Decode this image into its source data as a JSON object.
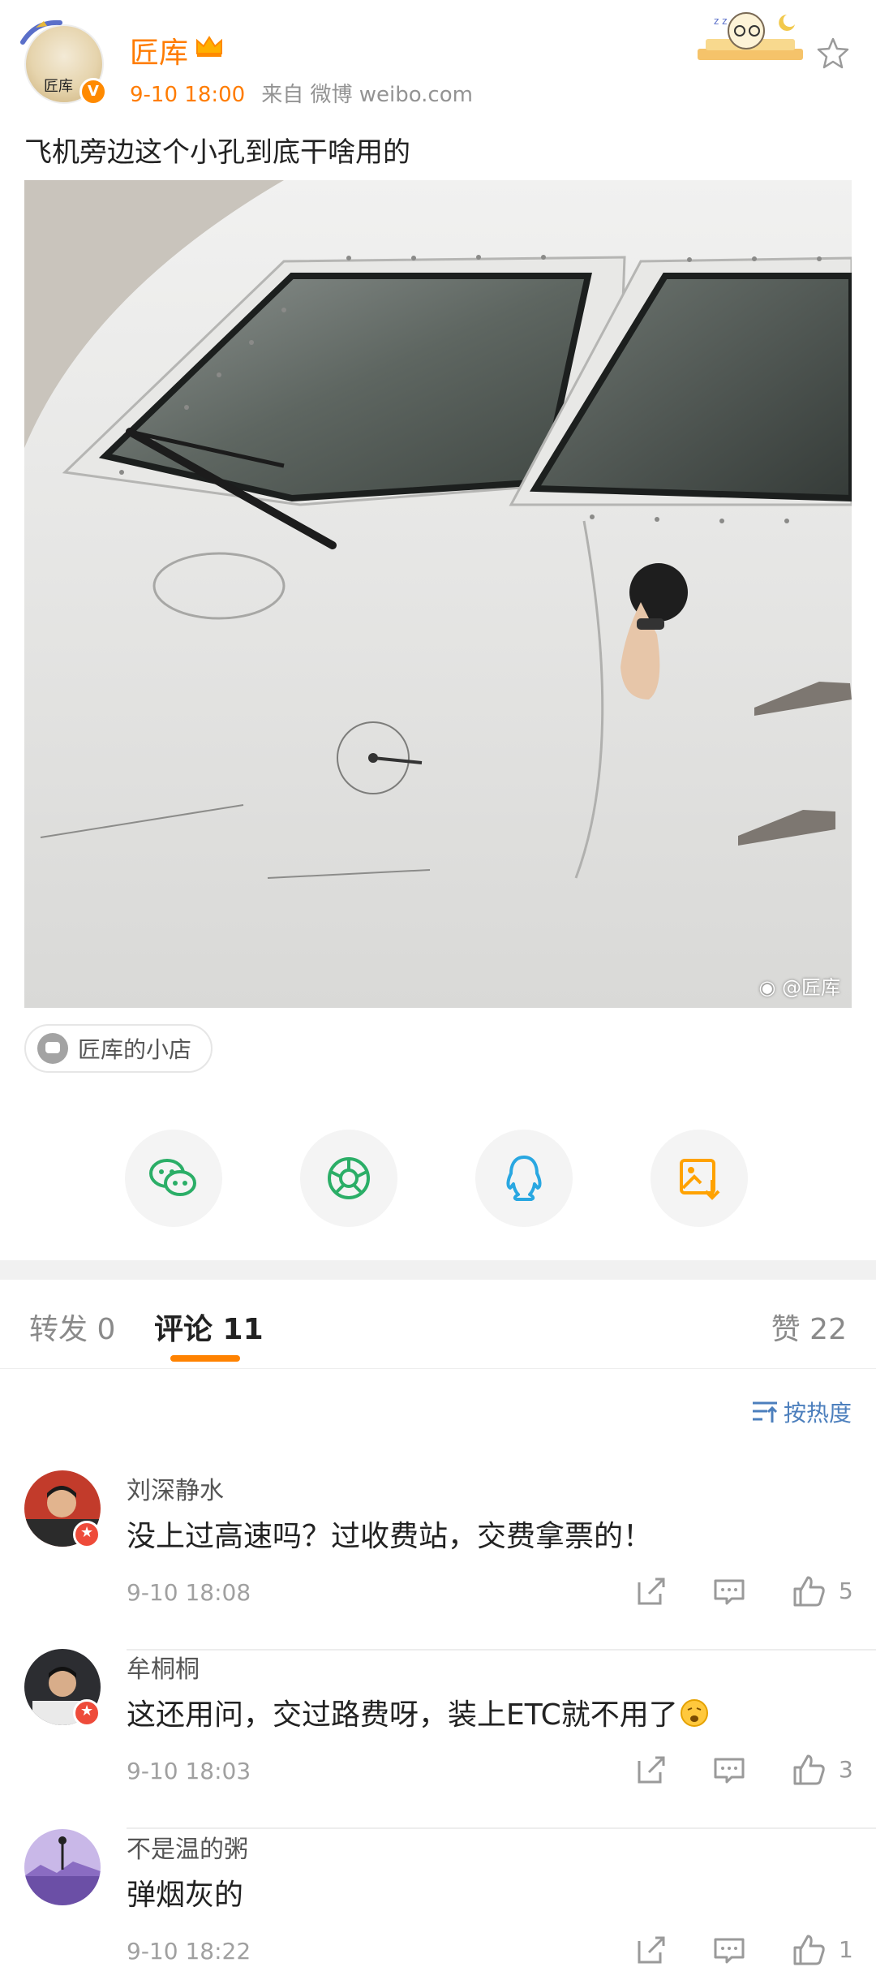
{
  "post": {
    "author": "匠库",
    "time": "9-10 18:00",
    "source": "来自 微博 weibo.com",
    "avatar_seal": "匠库",
    "text": "飞机旁边这个小孔到底干啥用的",
    "image_watermark": "@匠库",
    "verified_badge": "V"
  },
  "shop": {
    "label": "匠库的小店"
  },
  "share": {
    "buttons": [
      {
        "name": "wechat-icon",
        "color": "#2bae67"
      },
      {
        "name": "moments-icon",
        "color": "#2bae67"
      },
      {
        "name": "qq-icon",
        "color": "#29a7e1"
      },
      {
        "name": "save-image-icon",
        "color": "#ffa200"
      }
    ]
  },
  "tabs": {
    "repost": "转发 0",
    "comments": "评论 11",
    "likes": "赞 22"
  },
  "sort": {
    "label": "按热度"
  },
  "comments": [
    {
      "name": "刘深静水",
      "text": "没上过高速吗？过收费站，交费拿票的！",
      "time": "9-10 18:08",
      "likes": "5"
    },
    {
      "name": "牟桐桐",
      "text": "这还用问，交过路费呀，装上ETC就不用了",
      "time": "9-10 18:03",
      "likes": "3"
    },
    {
      "name": "不是温的粥",
      "text": "弹烟灰的",
      "time": "9-10 18:22",
      "likes": "1"
    }
  ],
  "colors": {
    "accent": "#ff7c00",
    "link": "#4c7fbd"
  }
}
